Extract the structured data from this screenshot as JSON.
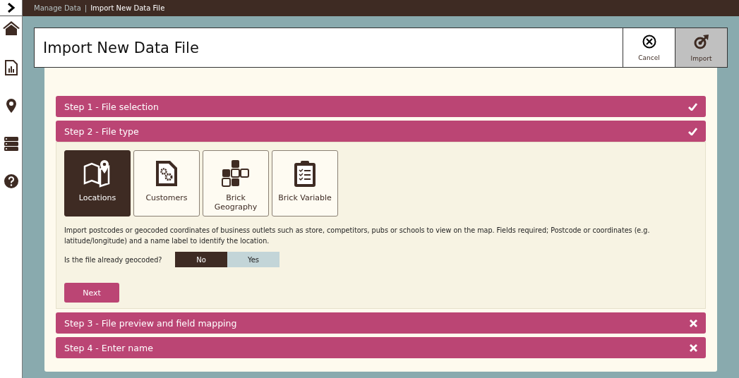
{
  "breadcrumb": {
    "parent": "Manage Data",
    "separator": "|",
    "current": "Import New Data File"
  },
  "page_title": "Import New Data File",
  "actions": [
    {
      "label": "Cancel",
      "kind": "cancel",
      "selected": false
    },
    {
      "label": "Import",
      "kind": "import",
      "selected": true
    }
  ],
  "steps": [
    {
      "title": "Step 1 - File selection",
      "completed": true,
      "expanded": false
    },
    {
      "title": "Step 2 - File type",
      "completed": true,
      "expanded": true
    },
    {
      "title": "Step 3 - File preview and field mapping",
      "completed": false,
      "expanded": false
    },
    {
      "title": "Step 4 - Enter name",
      "completed": false,
      "expanded": false
    }
  ],
  "file_types": [
    {
      "label": "Locations",
      "kind": "map",
      "selected": true
    },
    {
      "label": "Customers",
      "kind": "file-gears",
      "selected": false
    },
    {
      "label": "Brick Geography",
      "kind": "bricks",
      "selected": false
    },
    {
      "label": "Brick Variable",
      "kind": "clipboard",
      "selected": false
    }
  ],
  "description": "Import postcodes or geocoded coordinates of business outlets such as store, competitors, pubs or schools to view on the map. Fields required; Postcode or coordinates (e.g. latitude/longitude) and a name label to identify the location.",
  "geocoded": {
    "label": "Is the file already geocoded?",
    "options": [
      {
        "label": "No",
        "selected": true
      },
      {
        "label": "Yes",
        "selected": false
      }
    ]
  },
  "next_button": "Next"
}
